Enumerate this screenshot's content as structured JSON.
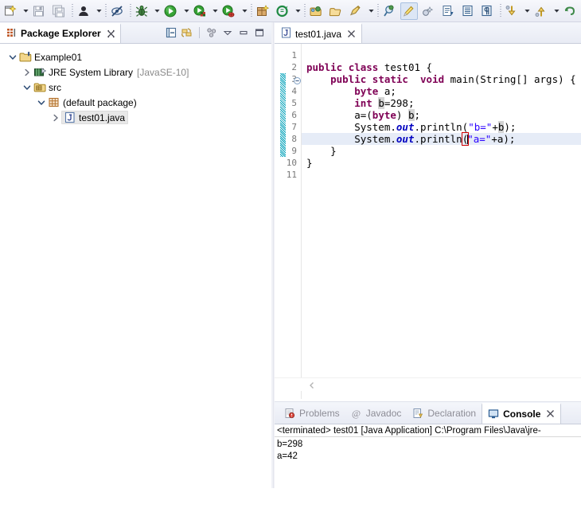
{
  "toolbar": {
    "items": [
      {
        "name": "new-wizard-icon",
        "label": "New",
        "type": "button"
      },
      {
        "name": "new-dropdown-arrow",
        "label": "New menu",
        "type": "arrow"
      },
      {
        "name": "save-icon",
        "label": "Save",
        "type": "button"
      },
      {
        "name": "save-all-icon",
        "label": "Save All",
        "type": "button"
      },
      {
        "name": "sep-1",
        "label": "separator",
        "type": "sep"
      },
      {
        "name": "person-icon",
        "label": "Open Task",
        "type": "button"
      },
      {
        "name": "person-dropdown-arrow",
        "label": "Task menu",
        "type": "arrow"
      },
      {
        "name": "sep-2",
        "label": "separator",
        "type": "sep"
      },
      {
        "name": "focus-off-icon",
        "label": "Focus on Active Task",
        "type": "button"
      },
      {
        "name": "sep-3",
        "label": "separator",
        "type": "sep"
      },
      {
        "name": "debug-icon",
        "label": "Debug",
        "type": "button"
      },
      {
        "name": "debug-dropdown-arrow",
        "label": "Debug menu",
        "type": "arrow"
      },
      {
        "name": "run-icon",
        "label": "Run",
        "type": "button"
      },
      {
        "name": "run-dropdown-arrow",
        "label": "Run menu",
        "type": "arrow"
      },
      {
        "name": "coverage-icon",
        "label": "Coverage",
        "type": "button"
      },
      {
        "name": "coverage-dropdown-arrow",
        "label": "Coverage menu",
        "type": "arrow"
      },
      {
        "name": "profile-icon",
        "label": "Profile",
        "type": "button"
      },
      {
        "name": "profile-dropdown-arrow",
        "label": "Profile menu",
        "type": "arrow"
      },
      {
        "name": "sep-4",
        "label": "separator",
        "type": "sep"
      },
      {
        "name": "new-java-package-icon",
        "label": "New Java Package",
        "type": "button"
      },
      {
        "name": "new-java-class-icon",
        "label": "New Java Class",
        "type": "button"
      },
      {
        "name": "new-class-dropdown-arrow",
        "label": "New Class menu",
        "type": "arrow"
      },
      {
        "name": "sep-5",
        "label": "separator",
        "type": "sep"
      },
      {
        "name": "open-type-icon",
        "label": "Open Type",
        "type": "button"
      },
      {
        "name": "open-task-icon",
        "label": "Open Task",
        "type": "button"
      },
      {
        "name": "search-icon",
        "label": "Search",
        "type": "button"
      },
      {
        "name": "search-dropdown-arrow",
        "label": "Search menu",
        "type": "arrow"
      },
      {
        "name": "sep-6",
        "label": "separator",
        "type": "sep"
      },
      {
        "name": "link-search-icon",
        "label": "Link with Editor",
        "type": "button"
      },
      {
        "name": "highlight-icon",
        "label": "Toggle Mark Occurrences",
        "type": "button",
        "active": true
      },
      {
        "name": "skip-breakpoints-icon",
        "label": "Skip All Breakpoints",
        "type": "button"
      },
      {
        "name": "next-annotation-icon",
        "label": "Next Annotation",
        "type": "button"
      },
      {
        "name": "show-whitespace-icon",
        "label": "Show Whitespace Characters",
        "type": "button"
      },
      {
        "name": "pilcrow-icon",
        "label": "Toggle Block Selection",
        "type": "button"
      },
      {
        "name": "sep-7",
        "label": "separator",
        "type": "sep"
      },
      {
        "name": "prev-edit-icon",
        "label": "Previous Edit Location",
        "type": "button"
      },
      {
        "name": "prev-dropdown-arrow",
        "label": "Previous menu",
        "type": "arrow"
      },
      {
        "name": "next-edit-icon",
        "label": "Next Edit Location",
        "type": "button"
      },
      {
        "name": "next-dropdown-arrow",
        "label": "Next menu",
        "type": "arrow"
      },
      {
        "name": "back-icon",
        "label": "Back",
        "type": "button"
      }
    ]
  },
  "package_explorer": {
    "tab_label": "Package Explorer",
    "close_tooltip": "Close",
    "toolbar": [
      {
        "name": "collapse-all-icon",
        "label": "Collapse All"
      },
      {
        "name": "link-with-editor-icon",
        "label": "Link with Editor"
      },
      {
        "name": "view-menu-icon",
        "label": "View Menu"
      },
      {
        "name": "minimize-icon",
        "label": "Minimize"
      },
      {
        "name": "maximize-icon",
        "label": "Maximize"
      }
    ],
    "tree": [
      {
        "label": "Example01",
        "suffix": "",
        "icon": "project-icon",
        "indent": 0,
        "twisty": "open",
        "selected": false
      },
      {
        "label": "JRE System Library",
        "suffix": "[JavaSE-10]",
        "icon": "library-icon",
        "indent": 1,
        "twisty": "closed",
        "selected": false
      },
      {
        "label": "src",
        "suffix": "",
        "icon": "source-folder-icon",
        "indent": 1,
        "twisty": "open",
        "selected": false
      },
      {
        "label": "(default package)",
        "suffix": "",
        "icon": "package-icon",
        "indent": 2,
        "twisty": "open",
        "selected": false
      },
      {
        "label": "test01.java",
        "suffix": "",
        "icon": "java-file-icon",
        "indent": 3,
        "twisty": "closed",
        "selected": true
      }
    ]
  },
  "editor": {
    "tab_label": "test01.java",
    "tab_icon": "java-file-icon",
    "line_numbers": [
      "1",
      "2",
      "3",
      "4",
      "5",
      "6",
      "7",
      "8",
      "9",
      "10",
      "11"
    ],
    "current_line": 8,
    "fold_marker_line": 3,
    "change_bar_lines": [
      3,
      4,
      5,
      6,
      7,
      8,
      9
    ],
    "lines": [
      "",
      "public class test01 {",
      "    public static  void main(String[] args) {",
      "        byte a;",
      "        int b=298;",
      "        a=(byte) b;",
      "        System.out.println(\"b=\"+b);",
      "        System.out.println(\"a=\"+a);",
      "    }",
      "}",
      ""
    ],
    "scroll_left_arrow": "scroll-left-icon"
  },
  "bottom_tabs": [
    {
      "name": "tab-problems",
      "label": "Problems",
      "icon": "problems-icon",
      "selected": false
    },
    {
      "name": "tab-javadoc",
      "label": "Javadoc",
      "icon": "javadoc-icon",
      "selected": false
    },
    {
      "name": "tab-declaration",
      "label": "Declaration",
      "icon": "declaration-icon",
      "selected": false
    },
    {
      "name": "tab-console",
      "label": "Console",
      "icon": "console-icon",
      "selected": true
    }
  ],
  "console": {
    "header": "<terminated> test01 [Java Application] C:\\Program Files\\Java\\jre-",
    "output": [
      "b=298",
      "a=42"
    ]
  },
  "colors": {
    "keyword": "#7f0055",
    "string": "#2a00ff",
    "field": "#0000c0",
    "occurrence_highlight": "#d4d4d4",
    "current_line": "#e6ecf7",
    "change_bar": "#00a0b8",
    "bracket_match_outline": "#d00000",
    "toolbar_bg": "#eef0f7",
    "tab_bg": "#e8ebf4"
  }
}
